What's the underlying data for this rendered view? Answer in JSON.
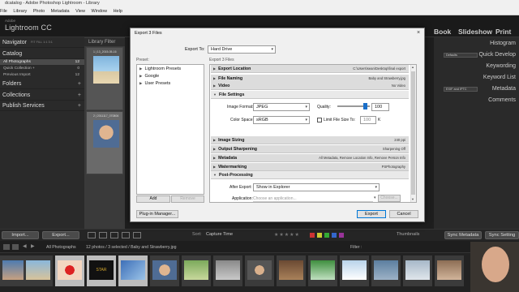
{
  "window": {
    "title": "dcatalog - Adobe Photoshop Lightroom - Library"
  },
  "menu": [
    "File",
    "Library",
    "Photo",
    "Metadata",
    "View",
    "Window",
    "Help"
  ],
  "header": {
    "brand_small": "Adobe",
    "brand": "Lightroom CC",
    "modules": [
      "Book",
      "Slideshow",
      "Print"
    ]
  },
  "left_panel": {
    "navigator": "Navigator",
    "navigator_opts": "FIT  FILL  1:1  3:1",
    "catalog": "Catalog",
    "catalog_items": [
      {
        "label": "All Photographs",
        "count": "12"
      },
      {
        "label": "Quick Collection +",
        "count": "0"
      },
      {
        "label": "Previous Import",
        "count": "12"
      }
    ],
    "folders": "Folders",
    "collections": "Collections",
    "publish": "Publish Services",
    "plus": "+"
  },
  "grid": {
    "title": "Library Filter",
    "cells": [
      {
        "label": "1 | 13_2015-05-16"
      },
      {
        "label": "2 | 2011117_070806"
      }
    ]
  },
  "right_panel": {
    "items": [
      "Histogram",
      "Quick Develop",
      "Keywording",
      "Keyword List",
      "Metadata",
      "Comments"
    ],
    "qd_select": "Defaults",
    "meta_select": "EXIF and IPTC"
  },
  "bottom": {
    "import": "Import...",
    "export": "Export...",
    "sort_label": "Sort:",
    "sort_value": "Capture Time",
    "thumbnails": "Thumbnails",
    "sync_meta": "Sync Metadata",
    "sync_settings": "Sync Setting"
  },
  "filmstrip_bar": {
    "source": "All Photographs",
    "count": "12 photos / 3 selected / Baby and Strawberry.jpg",
    "filter": "Filter :"
  },
  "dialog": {
    "title": "Export 3 Files",
    "close": "×",
    "export_to_label": "Export To:",
    "export_to_value": "Hard Drive",
    "preset_label": "Preset:",
    "file_label": "Export 3 Files",
    "presets": [
      "Lightroom Presets",
      "Google",
      "User Presets"
    ],
    "add": "Add",
    "remove": "Remove",
    "sections": [
      {
        "label": "Export Location",
        "summary": "C:\\Users\\sean\\Desktop\\final export",
        "open": false
      },
      {
        "label": "File Naming",
        "summary": "Baby and Strawberry.jpg",
        "open": false
      },
      {
        "label": "Video",
        "summary": "No Video",
        "open": false
      },
      {
        "label": "File Settings",
        "summary": "",
        "open": true
      },
      {
        "label": "Image Sizing",
        "summary": "240 ppi",
        "open": false
      },
      {
        "label": "Output Sharpening",
        "summary": "Sharpening Off",
        "open": false
      },
      {
        "label": "Metadata",
        "summary": "All Metadata, Remove Location Info, Remove Person Info",
        "open": false
      },
      {
        "label": "Watermarking",
        "summary": "PSPhotography",
        "open": false
      },
      {
        "label": "Post-Processing",
        "summary": "",
        "open": true
      }
    ],
    "file_settings": {
      "format_label": "Image Format:",
      "format_value": "JPEG",
      "quality_label": "Quality:",
      "quality_value": "100",
      "quality_level": 0.85,
      "colorspace_label": "Color Space:",
      "colorspace_value": "sRGB",
      "limit_label": "Limit File Size To:",
      "limit_value": "100",
      "limit_unit": "K"
    },
    "post": {
      "after_label": "After Export:",
      "after_value": "Show in Explorer",
      "app_label": "Application:",
      "app_placeholder": "Choose an application...",
      "choose": "Choose..."
    },
    "plugin_manager": "Plug-in Manager...",
    "export": "Export",
    "cancel": "Cancel"
  },
  "colors": {
    "accent": "#1a6fc9",
    "lr_bg": "#2a2a2a",
    "dialog_bg": "#f0f0f0"
  }
}
